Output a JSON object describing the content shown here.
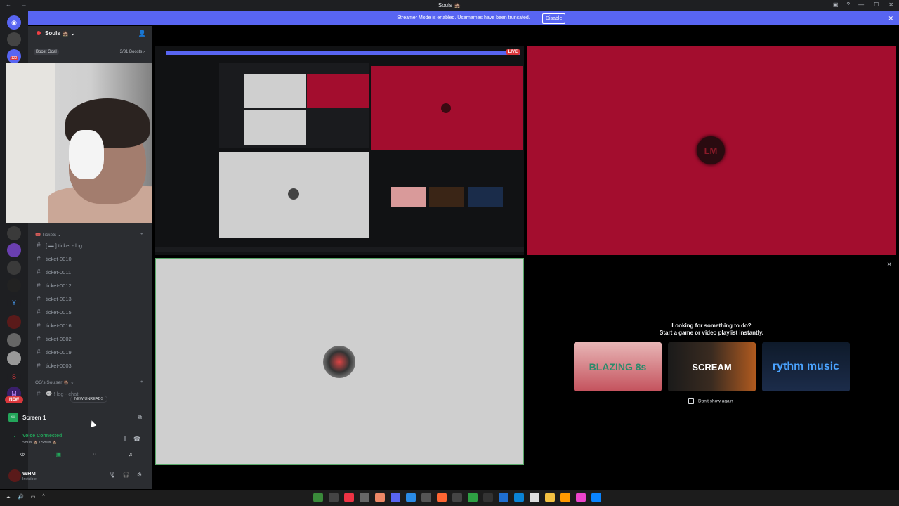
{
  "window": {
    "title": "Souls 🏚️",
    "nav_glyphs": "← →"
  },
  "banner": {
    "message": "Streamer Mode is enabled. Usernames have been truncated.",
    "button": "Disable",
    "close": "✕"
  },
  "server": {
    "name": "Souls 🏚️ ⌄",
    "boost_goal": "Boost Goal",
    "boost_count": "3/31 Boosts ›"
  },
  "guild_badges": {
    "count": "122",
    "new": "NEW"
  },
  "categories": [
    {
      "label": "🎟️ Tickets ⌄",
      "plus": "+"
    },
    {
      "label": "OG's Soulser 🏚️ ⌄",
      "plus": "+"
    }
  ],
  "channels": [
    "[ ▬ ] ticket - log",
    "ticket-0010",
    "ticket-0011",
    "ticket-0012",
    "ticket-0013",
    "ticket-0015",
    "ticket-0016",
    "ticket-0002",
    "ticket-0019",
    "ticket-0003"
  ],
  "channel_partial": "💬 ! log - chat",
  "new_unreads": "NEW UNREADS",
  "screen_share": {
    "label": "Screen 1"
  },
  "voice": {
    "status": "Voice Connected",
    "location": "Souls 🏚️ / Souls 🏚️"
  },
  "user": {
    "name": "WHM",
    "status": "Invisible"
  },
  "stream": {
    "live": "LIVE",
    "logo": "LM"
  },
  "suggest": {
    "line1": "Looking for something to do?",
    "line2": "Start a game or video playlist instantly.",
    "cards": [
      "BLAZING 8s",
      "SCREAM",
      "rythm music"
    ],
    "dont_show": "Don't show again",
    "close": "✕"
  },
  "colors": {
    "accent": "#5865f2",
    "stream_red": "#a30d2e",
    "voice_green": "#23a55a"
  }
}
